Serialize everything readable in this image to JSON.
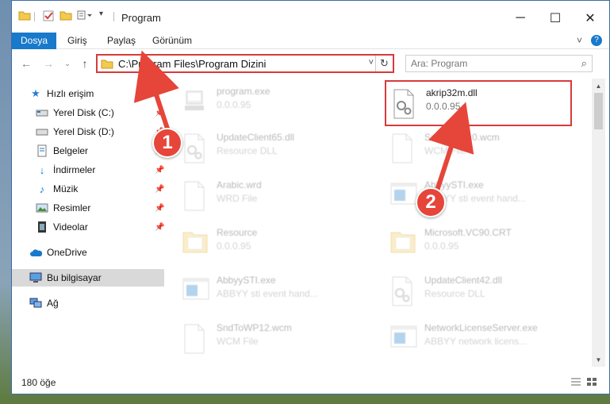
{
  "window": {
    "title": "Program",
    "controls": {
      "minimize": "─",
      "maximize": "☐",
      "close": "✕"
    }
  },
  "ribbon": {
    "tabs": [
      {
        "label": "Dosya",
        "active": true
      },
      {
        "label": "Giriş"
      },
      {
        "label": "Paylaş"
      },
      {
        "label": "Görünüm"
      }
    ],
    "help": "?",
    "expand": "˅"
  },
  "address": {
    "path": "C:\\Program Files\\Program Dizini",
    "search_placeholder": "Ara: Program"
  },
  "sidebar": {
    "items": [
      {
        "label": "Hızlı erişim",
        "icon": "star-icon"
      },
      {
        "label": "Yerel Disk (C:)",
        "icon": "drive-icon",
        "pinned": true
      },
      {
        "label": "Yerel Disk (D:)",
        "icon": "drive-icon",
        "pinned": true
      },
      {
        "label": "Belgeler",
        "icon": "documents-icon",
        "pinned": true
      },
      {
        "label": "İndirmeler",
        "icon": "downloads-icon",
        "pinned": true
      },
      {
        "label": "Müzik",
        "icon": "music-icon",
        "pinned": true
      },
      {
        "label": "Resimler",
        "icon": "pictures-icon",
        "pinned": true
      },
      {
        "label": "Videolar",
        "icon": "videos-icon",
        "pinned": true
      },
      {
        "label": "OneDrive",
        "icon": "cloud-icon"
      },
      {
        "label": "Bu bilgisayar",
        "icon": "computer-icon",
        "selected": true
      },
      {
        "label": "Ağ",
        "icon": "network-icon"
      }
    ]
  },
  "files": [
    {
      "name": "program.exe",
      "desc": "0.0.0.95",
      "kind": "exe",
      "faded": true
    },
    {
      "name": "akrip32m.dll",
      "desc": "0.0.0.95",
      "kind": "dll",
      "faded": false,
      "highlighted": true
    },
    {
      "name": "UpdateClient65.dll",
      "desc": "Resource DLL",
      "kind": "dll",
      "faded": true
    },
    {
      "name": "SndToWP10.wcm",
      "desc": "WCM File",
      "kind": "doc",
      "faded": true
    },
    {
      "name": "Arabic.wrd",
      "desc": "WRD File",
      "kind": "doc",
      "faded": true
    },
    {
      "name": "AbbyySTI.exe",
      "desc": "ABBYY sti event hand...",
      "kind": "app",
      "faded": true
    },
    {
      "name": "Resource",
      "desc": "0.0.0.95",
      "kind": "folder",
      "faded": true
    },
    {
      "name": "Microsoft.VC90.CRT",
      "desc": "0.0.0.95",
      "kind": "folder",
      "faded": true
    },
    {
      "name": "AbbyySTI.exe",
      "desc": "ABBYY sti event hand...",
      "kind": "app",
      "faded": true
    },
    {
      "name": "UpdateClient42.dll",
      "desc": "Resource DLL",
      "kind": "dll",
      "faded": true
    },
    {
      "name": "SndToWP12.wcm",
      "desc": "WCM File",
      "kind": "doc",
      "faded": true
    },
    {
      "name": "NetworkLicenseServer.exe",
      "desc": "ABBYY network licens...",
      "kind": "app",
      "faded": true
    }
  ],
  "status": {
    "count": "180 öğe"
  },
  "callouts": [
    {
      "label": "1"
    },
    {
      "label": "2"
    }
  ],
  "colors": {
    "accent": "#1979ca",
    "highlight": "#d83a3a",
    "callout": "#e6453a"
  }
}
